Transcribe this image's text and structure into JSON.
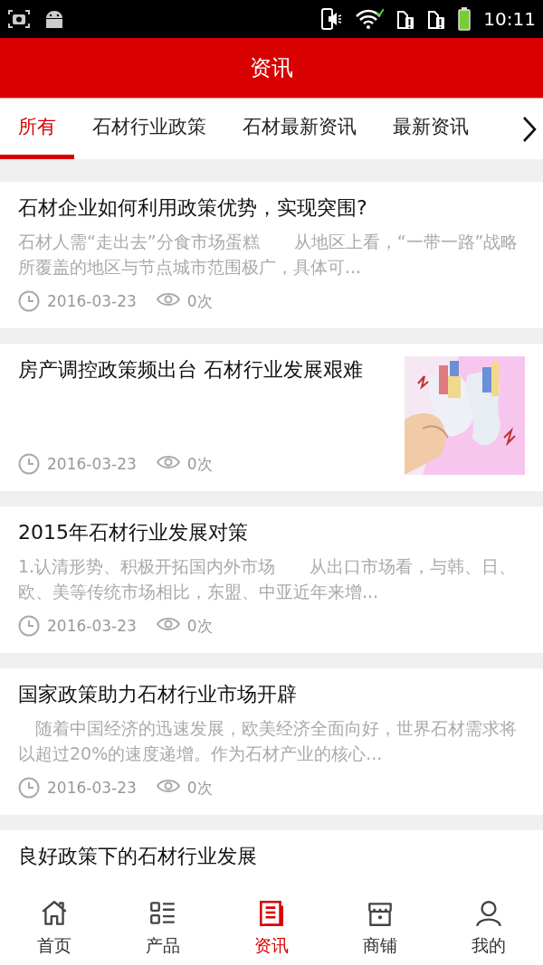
{
  "status_bar": {
    "time": "10:11"
  },
  "header": {
    "title": "资讯"
  },
  "tabs": [
    {
      "label": "所有",
      "selected": true
    },
    {
      "label": "石材行业政策",
      "selected": false
    },
    {
      "label": "石材最新资讯",
      "selected": false
    },
    {
      "label": "最新资讯",
      "selected": false
    }
  ],
  "articles": [
    {
      "title": "石材企业如何利用政策优势，实现突围?",
      "summary": "石材人需“走出去”分食市场蛋糕　　从地区上看，“一带一路”战略所覆盖的地区与节点城市范围极广，具体可...",
      "date": "2016-03-23",
      "views": "0次"
    },
    {
      "title": "房产调控政策频出台 石材行业发展艰难",
      "kind": "picture",
      "date": "2016-03-23",
      "views": "0次"
    },
    {
      "title": "2015年石材行业发展对策",
      "summary": "1.认清形势、积极开拓国内外市场　　从出口市场看，与韩、日、欧、美等传统市场相比，东盟、中亚近年来增...",
      "date": "2016-03-23",
      "views": "0次"
    },
    {
      "title": "国家政策助力石材行业市场开辟",
      "summary": "　随着中国经济的迅速发展，欧美经济全面向好，世界石材需求将以超过20%的速度递增。作为石材产业的核心...",
      "date": "2016-03-23",
      "views": "0次"
    },
    {
      "title": "良好政策下的石材行业发展"
    }
  ],
  "nav": [
    {
      "label": "首页",
      "selected": false
    },
    {
      "label": "产品",
      "selected": false
    },
    {
      "label": "资讯",
      "selected": true
    },
    {
      "label": "商铺",
      "selected": false
    },
    {
      "label": "我的",
      "selected": false
    }
  ]
}
